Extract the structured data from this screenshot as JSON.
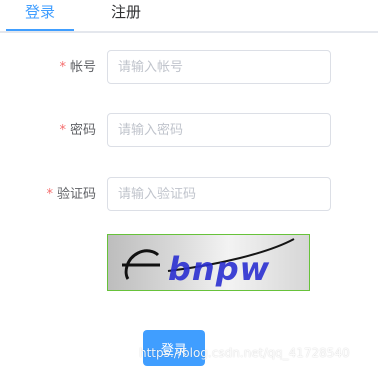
{
  "tabs": [
    {
      "label": "登录",
      "active": true
    },
    {
      "label": "注册",
      "active": false
    }
  ],
  "form": {
    "required_mark": "*",
    "account": {
      "label": "帐号",
      "placeholder": "请输入帐号",
      "value": ""
    },
    "password": {
      "label": "密码",
      "placeholder": "请输入密码",
      "value": ""
    },
    "captcha_field": {
      "label": "验证码",
      "placeholder": "请输入验证码",
      "value": ""
    }
  },
  "captcha_image": {
    "text": "bnpw"
  },
  "submit": {
    "label": "登录"
  },
  "watermark": "https://blog.csdn.net/qq_41728540",
  "colors": {
    "accent": "#409eff",
    "required": "#f56c6c",
    "captcha_border": "#67c23a"
  }
}
